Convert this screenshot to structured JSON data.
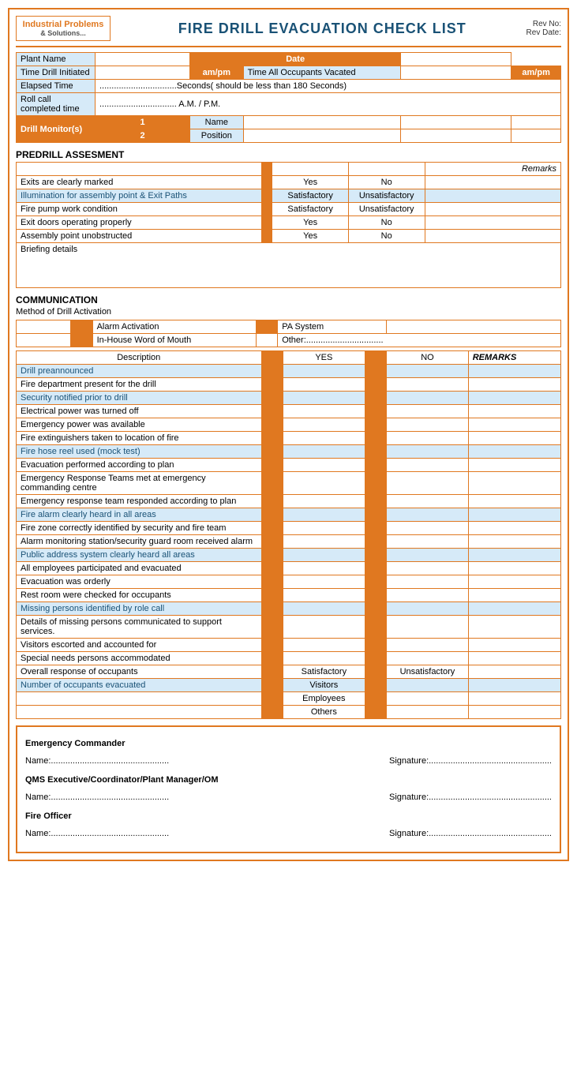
{
  "header": {
    "logo_line1": "Industrial Problems",
    "logo_line2": "& Solutions...",
    "title": "FIRE DRILL EVACUATION CHECK LIST",
    "rev_no": "Rev No:",
    "rev_date": "Rev Date:"
  },
  "info": {
    "plant_name_label": "Plant Name",
    "date_label": "Date",
    "time_drill_label": "Time Drill Initiated",
    "ampm1": "am/pm",
    "time_all_label": "Time All Occupants Vacated",
    "ampm2": "am/pm",
    "elapsed_label": "Elapsed Time",
    "elapsed_value": "................................Seconds( should be less than 180 Seconds)",
    "rollcall_label": "Roll call completed time",
    "rollcall_value": "................................ A.M. / P.M.",
    "drill_monitors_label": "Drill Monitor(s)",
    "monitor1_num": "1",
    "monitor1_name": "Name",
    "monitor2_num": "2",
    "monitor2_name": "Position"
  },
  "predrill": {
    "section_title": "PREDRILL ASSESMENT",
    "remarks_label": "Remarks",
    "rows": [
      {
        "label": "Exits are clearly marked",
        "col1": "Yes",
        "col2": "No",
        "blue": false
      },
      {
        "label": "Illumination for assembly point & Exit Paths",
        "col1": "Satisfactory",
        "col2": "Unsatisfactory",
        "blue": true
      },
      {
        "label": "Fire pump work condition",
        "col1": "Satisfactory",
        "col2": "Unsatisfactory",
        "blue": false
      },
      {
        "label": "Exit doors operating properly",
        "col1": "Yes",
        "col2": "No",
        "blue": false
      },
      {
        "label": "Assembly point unobstructed",
        "col1": "Yes",
        "col2": "No",
        "blue": false
      }
    ],
    "briefing_label": "Briefing details"
  },
  "communication": {
    "section_title": "COMMUNICATION",
    "method_label": "Method of Drill Activation",
    "options": [
      {
        "label": "Alarm Activation"
      },
      {
        "label": "PA System"
      },
      {
        "label": "In-House Word of Mouth"
      },
      {
        "label": "Other:................................"
      }
    ],
    "col_desc": "Description",
    "col_yes": "YES",
    "col_no": "NO",
    "col_remarks": "REMARKS",
    "rows": [
      {
        "label": "Drill preannounced",
        "blue": true
      },
      {
        "label": "Fire department present for the drill",
        "blue": false
      },
      {
        "label": "Security notified prior to drill",
        "blue": true
      },
      {
        "label": "Electrical power was turned off",
        "blue": false
      },
      {
        "label": "Emergency power was available",
        "blue": false
      },
      {
        "label": "Fire extinguishers taken to location of fire",
        "blue": false
      },
      {
        "label": "Fire hose reel used (mock test)",
        "blue": true
      },
      {
        "label": "Evacuation performed according to plan",
        "blue": false
      },
      {
        "label": "Emergency Response Teams met at emergency commanding centre",
        "blue": false
      },
      {
        "label": "Emergency response team responded according to plan",
        "blue": false
      },
      {
        "label": "Fire alarm clearly heard in all areas",
        "blue": true
      },
      {
        "label": "Fire zone correctly identified by security and fire team",
        "blue": false
      },
      {
        "label": "Alarm monitoring station/security guard room received alarm",
        "blue": false
      },
      {
        "label": "Public address system clearly heard all areas",
        "blue": true
      },
      {
        "label": "All employees participated and evacuated",
        "blue": false
      },
      {
        "label": "Evacuation was orderly",
        "blue": false
      },
      {
        "label": "Rest room were checked for occupants",
        "blue": false
      },
      {
        "label": "Missing persons identified by role call",
        "blue": true
      },
      {
        "label": "Details of missing persons communicated to support services.",
        "blue": false
      },
      {
        "label": "Visitors escorted and accounted for",
        "blue": false
      },
      {
        "label": "Special needs persons accommodated",
        "blue": false
      },
      {
        "label": "Overall response of occupants",
        "col1": "Satisfactory",
        "col2": "Unsatisfactory",
        "special": "satisfactory",
        "blue": false
      },
      {
        "label": "Number of occupants evacuated",
        "col1": "Visitors",
        "special": "occupants",
        "blue": true
      }
    ],
    "occupants_rows": [
      {
        "label": "Employees"
      },
      {
        "label": "Others"
      }
    ]
  },
  "signatures": {
    "commander_title": "Emergency Commander",
    "name_label": "Name:.................................................",
    "sig_label": "Signature:...................................................",
    "qms_title": "QMS Executive/Coordinator/Plant Manager/OM",
    "fire_officer_title": "Fire Officer"
  }
}
